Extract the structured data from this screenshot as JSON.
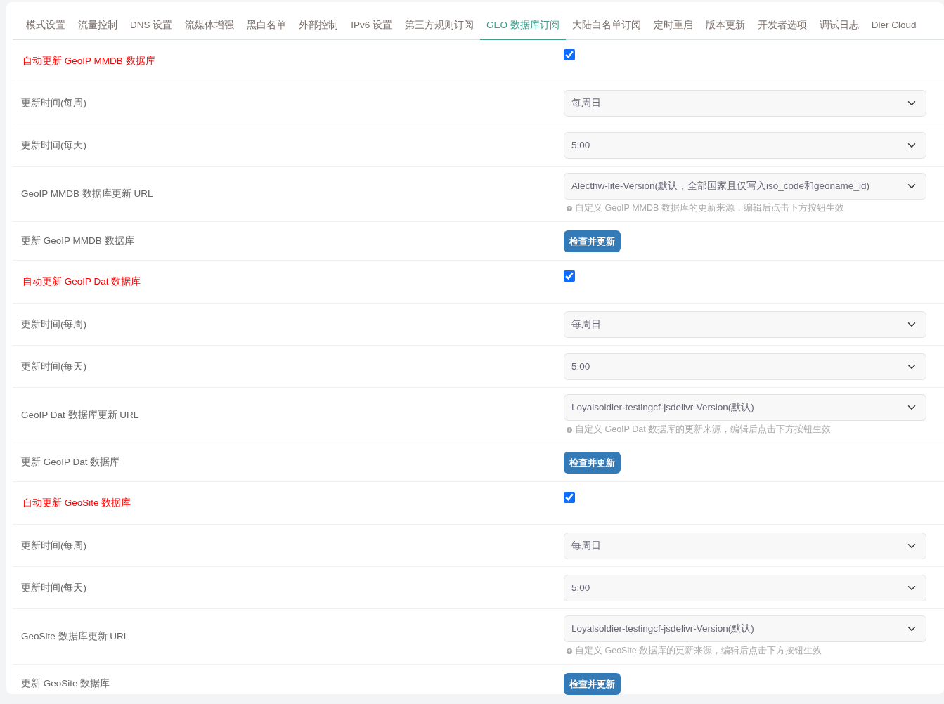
{
  "tabs": [
    {
      "label": "模式设置",
      "selected": false
    },
    {
      "label": "流量控制",
      "selected": false
    },
    {
      "label": "DNS 设置",
      "selected": false
    },
    {
      "label": "流媒体增强",
      "selected": false
    },
    {
      "label": "黑白名单",
      "selected": false
    },
    {
      "label": "外部控制",
      "selected": false
    },
    {
      "label": "IPv6 设置",
      "selected": false
    },
    {
      "label": "第三方规则订阅",
      "selected": false
    },
    {
      "label": "GEO 数据库订阅",
      "selected": true
    },
    {
      "label": "大陆白名单订阅",
      "selected": false
    },
    {
      "label": "定时重启",
      "selected": false
    },
    {
      "label": "版本更新",
      "selected": false
    },
    {
      "label": "开发者选项",
      "selected": false
    },
    {
      "label": "调试日志",
      "selected": false
    },
    {
      "label": "Dler Cloud",
      "selected": false
    }
  ],
  "rows": [
    {
      "kind": "checkbox",
      "label": "自动更新 GeoIP MMDB 数据库",
      "checked": true
    },
    {
      "kind": "select",
      "label": "更新时间(每周)",
      "value": "每周日"
    },
    {
      "kind": "select",
      "label": "更新时间(每天)",
      "value": "5:00"
    },
    {
      "kind": "select",
      "label": "GeoIP MMDB 数据库更新 URL",
      "value": "Alecthw-lite-Version(默认，全部国家且仅写入iso_code和geoname_id)",
      "hint": "自定义 GeoIP MMDB 数据库的更新来源，编辑后点击下方按钮生效"
    },
    {
      "kind": "button",
      "label": "更新 GeoIP MMDB 数据库",
      "button": "检查并更新"
    },
    {
      "kind": "checkbox",
      "label": "自动更新 GeoIP Dat 数据库",
      "checked": true
    },
    {
      "kind": "select",
      "label": "更新时间(每周)",
      "value": "每周日"
    },
    {
      "kind": "select",
      "label": "更新时间(每天)",
      "value": "5:00"
    },
    {
      "kind": "select",
      "label": "GeoIP Dat 数据库更新 URL",
      "value": "Loyalsoldier-testingcf-jsdelivr-Version(默认)",
      "hint": "自定义 GeoIP Dat 数据库的更新来源，编辑后点击下方按钮生效"
    },
    {
      "kind": "button",
      "label": "更新 GeoIP Dat 数据库",
      "button": "检查并更新"
    },
    {
      "kind": "checkbox",
      "label": "自动更新 GeoSite 数据库",
      "checked": true
    },
    {
      "kind": "select",
      "label": "更新时间(每周)",
      "value": "每周日"
    },
    {
      "kind": "select",
      "label": "更新时间(每天)",
      "value": "5:00"
    },
    {
      "kind": "select",
      "label": "GeoSite 数据库更新 URL",
      "value": "Loyalsoldier-testingcf-jsdelivr-Version(默认)",
      "hint": "自定义 GeoSite 数据库的更新来源，编辑后点击下方按钮生效"
    },
    {
      "kind": "button",
      "label": "更新 GeoSite 数据库",
      "button": "检查并更新"
    }
  ]
}
